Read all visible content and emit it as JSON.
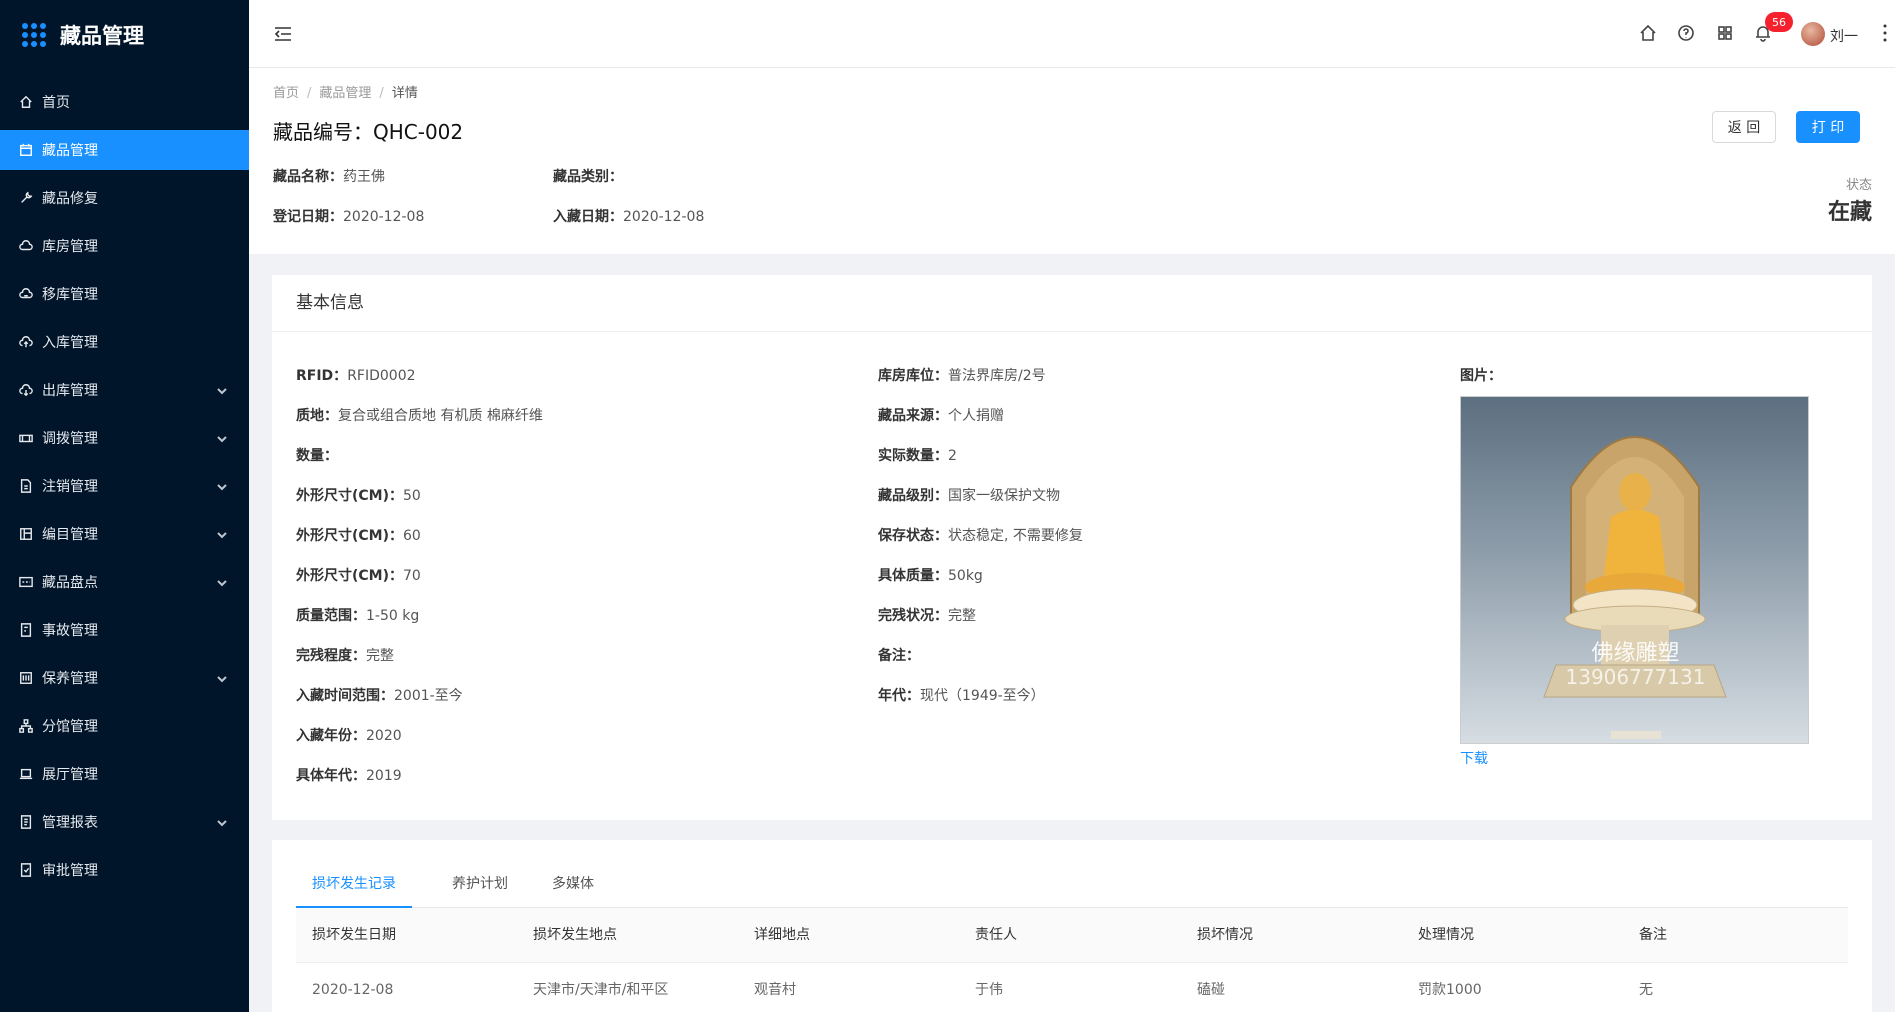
{
  "sidebar": {
    "brand": "藏品管理",
    "items": [
      {
        "label": "首页",
        "icon": "home-icon"
      },
      {
        "label": "藏品管理",
        "icon": "calendar-icon",
        "active": true
      },
      {
        "label": "藏品修复",
        "icon": "wrench-icon"
      },
      {
        "label": "库房管理",
        "icon": "cloud-icon"
      },
      {
        "label": "移库管理",
        "icon": "cloud-sync-icon"
      },
      {
        "label": "入库管理",
        "icon": "cloud-upload-icon"
      },
      {
        "label": "出库管理",
        "icon": "cloud-download-icon",
        "expandable": true
      },
      {
        "label": "调拨管理",
        "icon": "transfer-icon",
        "expandable": true
      },
      {
        "label": "注销管理",
        "icon": "file-icon",
        "expandable": true
      },
      {
        "label": "编目管理",
        "icon": "layout-icon",
        "expandable": true
      },
      {
        "label": "藏品盘点",
        "icon": "calendar-check-icon",
        "expandable": true
      },
      {
        "label": "事故管理",
        "icon": "file-warning-icon"
      },
      {
        "label": "保养管理",
        "icon": "library-icon",
        "expandable": true
      },
      {
        "label": "分馆管理",
        "icon": "cluster-icon"
      },
      {
        "label": "展厅管理",
        "icon": "laptop-icon"
      },
      {
        "label": "管理报表",
        "icon": "report-icon",
        "expandable": true
      },
      {
        "label": "审批管理",
        "icon": "audit-icon"
      }
    ]
  },
  "header": {
    "notification_count": "56",
    "username": "刘一"
  },
  "page": {
    "breadcrumb": [
      "首页",
      "藏品管理",
      "详情"
    ],
    "title": "藏品编号：QHC-002",
    "back_label": "返 回",
    "print_label": "打 印",
    "name_label": "藏品名称：",
    "name_value": "药王佛",
    "category_label": "藏品类别：",
    "category_value": "",
    "register_label": "登记日期：",
    "register_value": "2020-12-08",
    "collect_label": "入藏日期：",
    "collect_value": "2020-12-08",
    "status_label": "状态",
    "status_value": "在藏"
  },
  "basic_info": {
    "title": "基本信息",
    "left": [
      {
        "label": "RFID：",
        "value": "RFID0002"
      },
      {
        "label": "质地：",
        "value": "复合或组合质地 有机质 棉麻纤维"
      },
      {
        "label": "数量：",
        "value": ""
      },
      {
        "label": "外形尺寸(CM)：",
        "value": "50"
      },
      {
        "label": "外形尺寸(CM)：",
        "value": "60"
      },
      {
        "label": "外形尺寸(CM)：",
        "value": "70"
      },
      {
        "label": "质量范围：",
        "value": "1-50 kg"
      },
      {
        "label": "完残程度：",
        "value": "完整"
      },
      {
        "label": "入藏时间范围：",
        "value": "2001-至今"
      },
      {
        "label": "入藏年份：",
        "value": "2020"
      },
      {
        "label": "具体年代：",
        "value": "2019"
      }
    ],
    "middle": [
      {
        "label": "库房库位：",
        "value": "普法界库房/2号"
      },
      {
        "label": "藏品来源：",
        "value": "个人捐赠"
      },
      {
        "label": "实际数量：",
        "value": "2"
      },
      {
        "label": "藏品级别：",
        "value": "国家一级保护文物"
      },
      {
        "label": "保存状态：",
        "value": "状态稳定, 不需要修复"
      },
      {
        "label": "具体质量：",
        "value": "50kg"
      },
      {
        "label": "完残状况：",
        "value": "完整"
      },
      {
        "label": "备注：",
        "value": ""
      },
      {
        "label": "年代：",
        "value": "现代（1949-至今）"
      }
    ],
    "image_label": "图片：",
    "image_watermark_1": "佛缘雕塑",
    "image_watermark_2": "13906777131",
    "download_label": "下载"
  },
  "tabs": [
    {
      "label": "损坏发生记录",
      "active": true
    },
    {
      "label": "养护计划"
    },
    {
      "label": "多媒体"
    }
  ],
  "table": {
    "headers": [
      "损坏发生日期",
      "损坏发生地点",
      "详细地点",
      "责任人",
      "损坏情况",
      "处理情况",
      "备注"
    ],
    "rows": [
      [
        "2020-12-08",
        "天津市/天津市/和平区",
        "观音村",
        "于伟",
        "磕碰",
        "罚款1000",
        "无"
      ]
    ]
  },
  "colors": {
    "sidebar_bg": "#001529",
    "primary": "#1890ff",
    "badge": "#f5222d"
  }
}
